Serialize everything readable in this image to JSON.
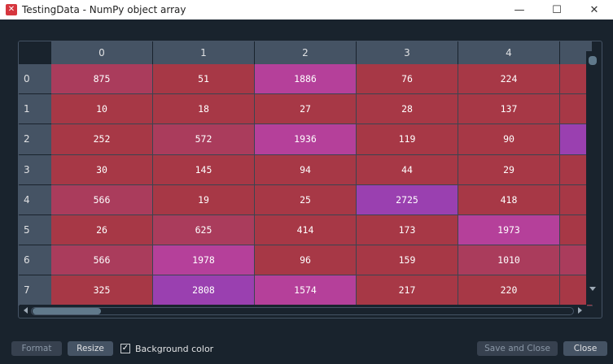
{
  "window": {
    "title": "TestingData - NumPy object array",
    "app_icon": "spyder-icon",
    "minimize_glyph": "—",
    "maximize_glyph": "☐",
    "close_glyph": "✕"
  },
  "table": {
    "columns": [
      "0",
      "1",
      "2",
      "3",
      "4"
    ],
    "rows": [
      "0",
      "1",
      "2",
      "3",
      "4",
      "5",
      "6",
      "7"
    ],
    "cells": [
      [
        "875",
        "51",
        "1886",
        "76",
        "224"
      ],
      [
        "10",
        "18",
        "27",
        "28",
        "137"
      ],
      [
        "252",
        "572",
        "1936",
        "119",
        "90"
      ],
      [
        "30",
        "145",
        "94",
        "44",
        "29"
      ],
      [
        "566",
        "19",
        "25",
        "2725",
        "418"
      ],
      [
        "26",
        "625",
        "414",
        "173",
        "1973"
      ],
      [
        "566",
        "1978",
        "96",
        "159",
        "1010"
      ],
      [
        "325",
        "2808",
        "1574",
        "217",
        "220"
      ]
    ],
    "colors": [
      [
        "#aa3c5c",
        "#a73846",
        "#b5409a",
        "#a73846",
        "#a73846",
        "#a73846"
      ],
      [
        "#a73846",
        "#a73846",
        "#a73846",
        "#a73846",
        "#a73846",
        "#a73846"
      ],
      [
        "#a73846",
        "#aa3c5c",
        "#b5409a",
        "#a73846",
        "#a73846",
        "#9a40b0"
      ],
      [
        "#a73846",
        "#a73846",
        "#a73846",
        "#a73846",
        "#a73846",
        "#a73846"
      ],
      [
        "#aa3c5c",
        "#a73846",
        "#a73846",
        "#9a40b0",
        "#a73846",
        "#a73846"
      ],
      [
        "#a73846",
        "#aa3c5c",
        "#a73846",
        "#a73846",
        "#b5409a",
        "#a73846"
      ],
      [
        "#aa3c5c",
        "#b5409a",
        "#a73846",
        "#a73846",
        "#aa3c5c",
        "#aa3c5c"
      ],
      [
        "#a73846",
        "#9a40b0",
        "#b5409a",
        "#a73846",
        "#a73846",
        "#a73846"
      ]
    ]
  },
  "footer": {
    "format_label": "Format",
    "resize_label": "Resize",
    "background_color_label": "Background color",
    "background_color_checked": true,
    "save_close_label": "Save and Close",
    "close_label": "Close"
  }
}
